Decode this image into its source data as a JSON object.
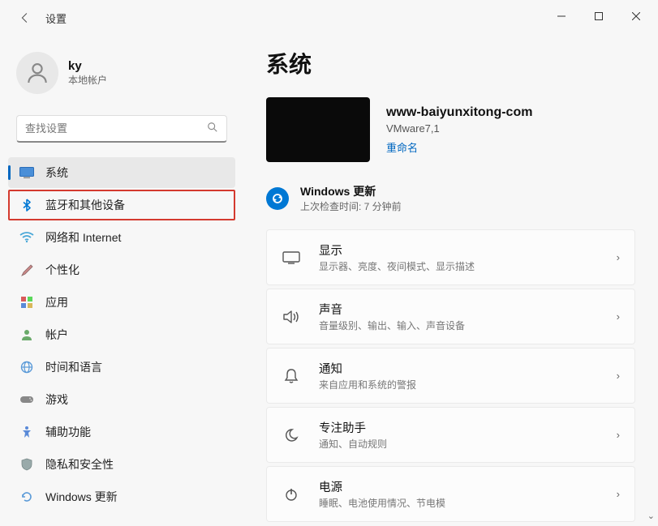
{
  "app": {
    "title": "设置"
  },
  "user": {
    "name": "ky",
    "account_type": "本地帐户"
  },
  "search": {
    "placeholder": "查找设置"
  },
  "nav": {
    "items": [
      {
        "label": "系统"
      },
      {
        "label": "蓝牙和其他设备"
      },
      {
        "label": "网络和 Internet"
      },
      {
        "label": "个性化"
      },
      {
        "label": "应用"
      },
      {
        "label": "帐户"
      },
      {
        "label": "时间和语言"
      },
      {
        "label": "游戏"
      },
      {
        "label": "辅助功能"
      },
      {
        "label": "隐私和安全性"
      },
      {
        "label": "Windows 更新"
      }
    ]
  },
  "page": {
    "title": "系统"
  },
  "device": {
    "name": "www-baiyunxitong-com",
    "model": "VMware7,1",
    "rename": "重命名"
  },
  "update": {
    "title": "Windows 更新",
    "subtitle": "上次检查时间: 7 分钟前"
  },
  "cards": [
    {
      "title": "显示",
      "sub": "显示器、亮度、夜间模式、显示描述"
    },
    {
      "title": "声音",
      "sub": "音量级别、输出、输入、声音设备"
    },
    {
      "title": "通知",
      "sub": "来自应用和系统的警报"
    },
    {
      "title": "专注助手",
      "sub": "通知、自动规则"
    },
    {
      "title": "电源",
      "sub": "睡眠、电池使用情况、节电模"
    }
  ]
}
